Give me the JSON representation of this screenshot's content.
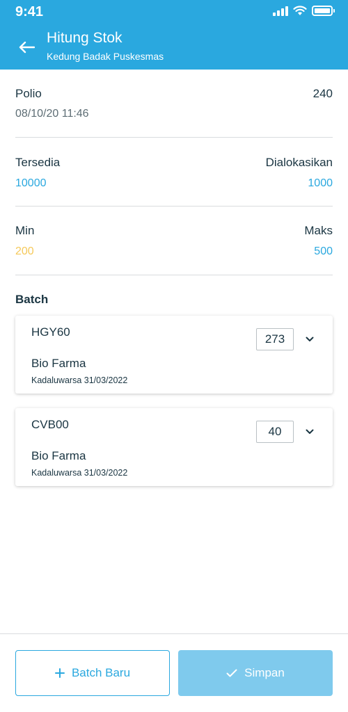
{
  "status": {
    "time": "9:41"
  },
  "header": {
    "title": "Hitung Stok",
    "subtitle": "Kedung Badak Puskesmas"
  },
  "item": {
    "name": "Polio",
    "count": "240",
    "datetime": "08/10/20 11:46"
  },
  "availability": {
    "tersedia_label": "Tersedia",
    "tersedia_value": "10000",
    "dialokasikan_label": "Dialokasikan",
    "dialokasikan_value": "1000"
  },
  "limits": {
    "min_label": "Min",
    "min_value": "200",
    "maks_label": "Maks",
    "maks_value": "500"
  },
  "batch_heading": "Batch",
  "batches": [
    {
      "code": "HGY60",
      "quantity": "273",
      "manufacturer": "Bio Farma",
      "expiry": "Kadaluwarsa 31/03/2022"
    },
    {
      "code": "CVB00",
      "quantity": "40",
      "manufacturer": "Bio Farma",
      "expiry": "Kadaluwarsa 31/03/2022"
    }
  ],
  "actions": {
    "add_batch_label": "Batch Baru",
    "save_label": "Simpan"
  },
  "colors": {
    "primary": "#2aa8df",
    "min_value": "#f5c95a",
    "save_disabled": "#7fcaed"
  },
  "icons": {
    "back": "arrow-left-icon",
    "dropdown": "chevron-down-icon",
    "add": "plus-icon",
    "save": "check-icon"
  }
}
